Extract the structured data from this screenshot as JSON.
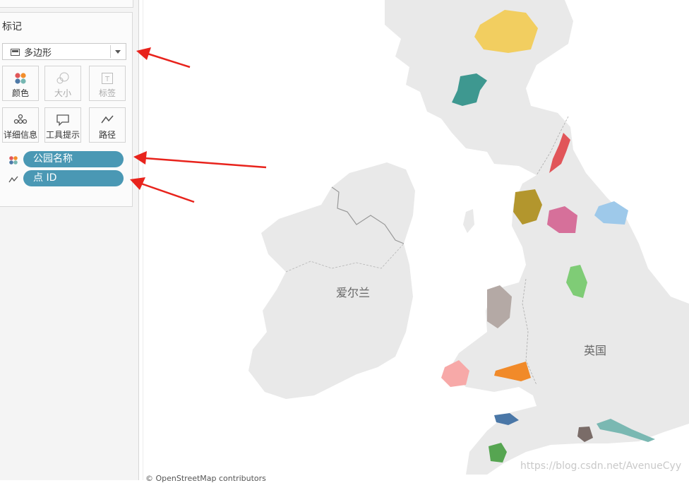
{
  "marks_panel": {
    "title": "标记",
    "mark_type": "多边形",
    "buttons": [
      {
        "label": "颜色",
        "icon": "color-dots-icon",
        "enabled": true
      },
      {
        "label": "大小",
        "icon": "size-circles-icon",
        "enabled": false
      },
      {
        "label": "标签",
        "icon": "label-t-icon",
        "enabled": false
      },
      {
        "label": "详细信息",
        "icon": "detail-dots-icon",
        "enabled": true
      },
      {
        "label": "工具提示",
        "icon": "tooltip-bubble-icon",
        "enabled": true
      },
      {
        "label": "路径",
        "icon": "path-line-icon",
        "enabled": true
      }
    ],
    "pills": [
      {
        "label": "公园名称",
        "icon": "color-dots-icon"
      },
      {
        "label": "点 ID",
        "icon": "path-line-icon"
      }
    ]
  },
  "map": {
    "labels": {
      "ireland": "爱尔兰",
      "uk": "英国"
    },
    "attribution": "© OpenStreetMap contributors",
    "watermark": "https://blog.csdn.net/AvenueCyy",
    "park_colors": [
      "#f2ce60",
      "#3e9890",
      "#e15559",
      "#b3962d",
      "#d6709a",
      "#9ec9ea",
      "#7fcc76",
      "#b4a9a5",
      "#f7a9a8",
      "#f18a29",
      "#4a77a7",
      "#7a6c68",
      "#7ab8b2",
      "#56a551"
    ]
  },
  "colors": {
    "pill": "#4a98b4",
    "arrow": "#e8231c",
    "land": "#e9e9e9"
  }
}
